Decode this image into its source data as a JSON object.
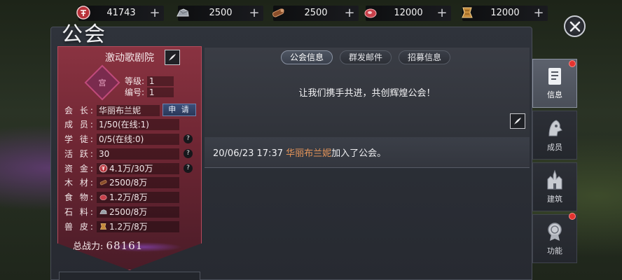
{
  "resources": [
    {
      "icon": "coin-icon",
      "value": "41743"
    },
    {
      "icon": "ore-icon",
      "value": "2500"
    },
    {
      "icon": "wood-icon",
      "value": "2500"
    },
    {
      "icon": "meat-icon",
      "value": "12000"
    },
    {
      "icon": "hide-icon",
      "value": "12000"
    }
  ],
  "window_title": "公会",
  "guild": {
    "name": "激动歌剧院",
    "emblem_glyph": "宫",
    "level_label": "等级:",
    "level_value": "1",
    "number_label": "编号:",
    "number_value": "1",
    "apply_label": "申 请",
    "rows": [
      {
        "label": "会 长:",
        "value": "华丽布兰妮"
      },
      {
        "label": "成 员:",
        "value": "1/50(在线:1)"
      },
      {
        "label": "学 徒:",
        "value": "0/5(在线:0)"
      },
      {
        "label": "活 跃:",
        "value": "30"
      },
      {
        "label": "资 金:",
        "value": "4.1万/30万"
      },
      {
        "label": "木 材:",
        "value": "2500/8万"
      },
      {
        "label": "食 物:",
        "value": "1.2万/8万"
      },
      {
        "label": "石 料:",
        "value": "2500/8万"
      },
      {
        "label": "兽 皮:",
        "value": "1.2万/8万"
      }
    ],
    "power_label": "总战力:",
    "power_value": "68161"
  },
  "tabs": [
    {
      "label": "公会信息",
      "active": true
    },
    {
      "label": "群发邮件",
      "active": false
    },
    {
      "label": "招募信息",
      "active": false
    }
  ],
  "notice": "让我们携手共进，共创辉煌公会！",
  "log": {
    "time": "20/06/23 17:37",
    "who": "华丽布兰妮",
    "text": "加入了公会。"
  },
  "side_tabs": [
    {
      "label": "信息",
      "active": true,
      "badge": true
    },
    {
      "label": "成员",
      "active": false,
      "badge": false
    },
    {
      "label": "建筑",
      "active": false,
      "badge": false
    },
    {
      "label": "功能",
      "active": false,
      "badge": true
    }
  ],
  "colors": {
    "card_red": "#8a3341",
    "log_name_orange": "#e6955a",
    "badge_red": "#e5332f"
  }
}
